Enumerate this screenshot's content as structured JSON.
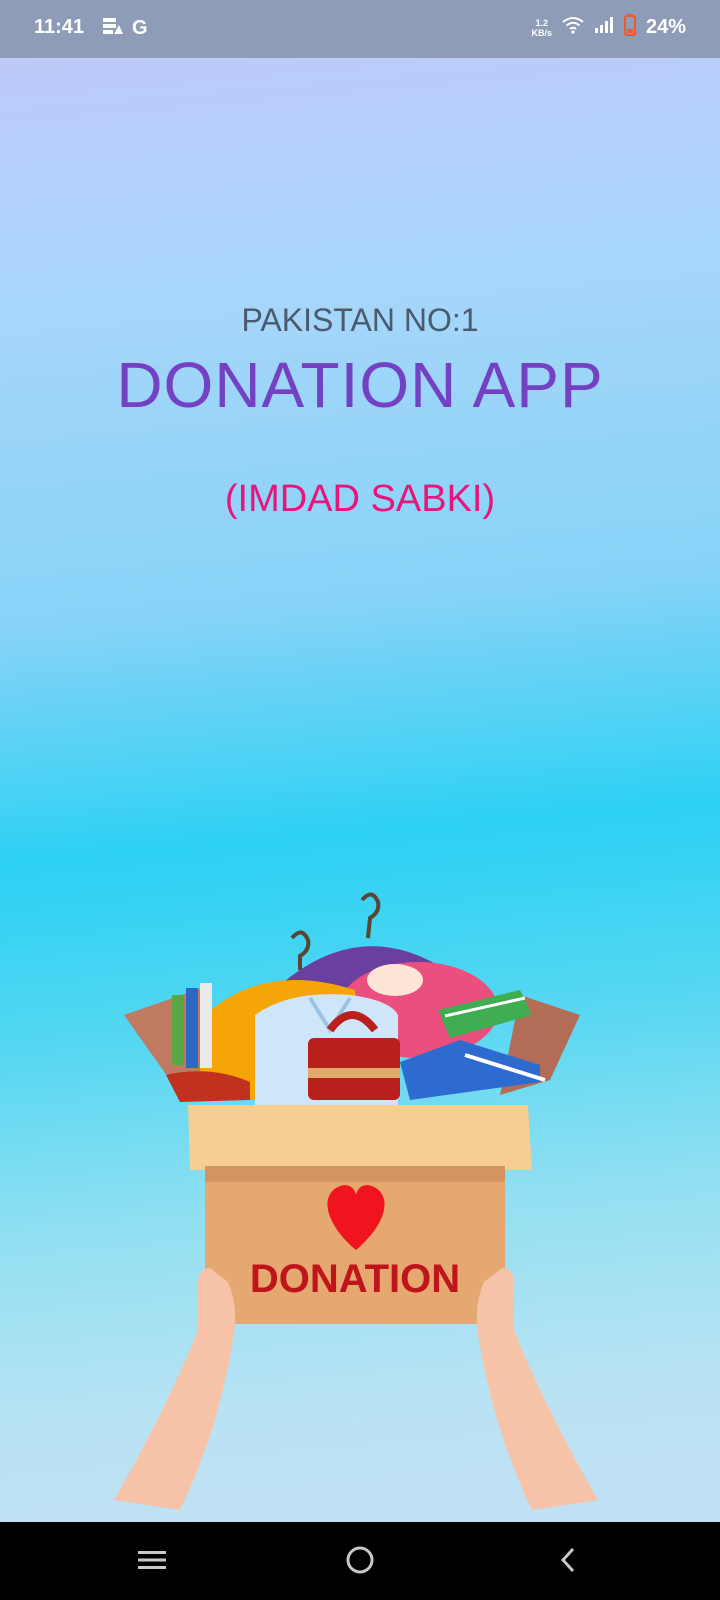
{
  "status_bar": {
    "time": "11:41",
    "carrier_icon_letter": "G",
    "net_speed_value": "1.2",
    "net_speed_unit": "KB/s",
    "battery": "24%",
    "icons": [
      "data-saver-icon",
      "google-icon",
      "wifi-icon",
      "signal-icon",
      "battery-icon"
    ]
  },
  "splash": {
    "subtitle": "PAKISTAN NO:1",
    "title": "DONATION APP",
    "tagline": "(IMDAD SABKI)",
    "box_label": "DONATION"
  },
  "colors": {
    "title": "#7441c4",
    "subtitle": "#4c5a6e",
    "tagline": "#e8157a",
    "box_label": "#c0141b"
  },
  "nav_bar": {
    "buttons": [
      "menu-icon",
      "home-icon",
      "back-icon"
    ]
  }
}
